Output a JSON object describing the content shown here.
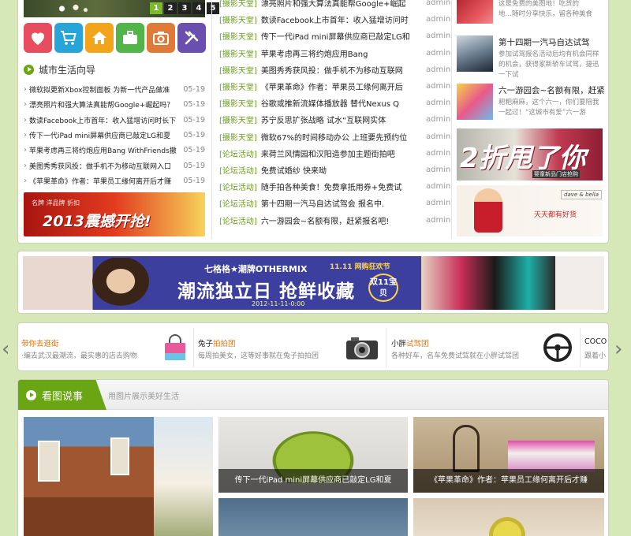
{
  "slider": {
    "pages": [
      "1",
      "2",
      "3",
      "4",
      "5"
    ],
    "active": "1"
  },
  "icon_buttons": [
    {
      "name": "heart-icon",
      "color": "#e84c5f"
    },
    {
      "name": "cart-icon",
      "color": "#27a5d8"
    },
    {
      "name": "home-icon",
      "color": "#f2a51a"
    },
    {
      "name": "briefcase-icon",
      "color": "#52b548"
    },
    {
      "name": "camera-icon",
      "color": "#e07a38"
    },
    {
      "name": "tools-icon",
      "color": "#6a4fb0"
    }
  ],
  "guide": {
    "title": "城市生活向导",
    "items": [
      {
        "text": "微软拟更新Xbox控制面板 为新一代产品做准",
        "date": "05-19"
      },
      {
        "text": "漂亮照片和强大算法真能帮Google+崛起吗？",
        "date": "05-19"
      },
      {
        "text": "数读Facebook上市首年：收入猛增访问时长下",
        "date": "05-19"
      },
      {
        "text": "传下一代iPad mini屏幕供应商已敲定LG和夏",
        "date": "05-19"
      },
      {
        "text": "苹果考虑再三将约炮应用Bang WithFriends撤",
        "date": "05-19"
      },
      {
        "text": "美图秀秀获风投：做手机不为移动互联网入口",
        "date": "05-19"
      },
      {
        "text": "《苹果革命》作者：苹果员工缘何离开后才赚",
        "date": "05-19"
      }
    ]
  },
  "ad_2013": {
    "text_small": "名牌  洋品牌  折扣",
    "text_big": "2013震撼开抢!"
  },
  "mid_list": [
    {
      "cat": "[摄影天堂]",
      "text": "漂亮照片和强大算法真能帮Google+崛起",
      "author": "admin"
    },
    {
      "cat": "[摄影天堂]",
      "text": "数读Facebook上市首年：收入猛增访问时",
      "author": "admin"
    },
    {
      "cat": "[摄影天堂]",
      "text": "传下一代iPad mini屏幕供应商已敲定LG和",
      "author": "admin"
    },
    {
      "cat": "[摄影天堂]",
      "text": "苹果考虑再三将约炮应用Bang",
      "author": "admin"
    },
    {
      "cat": "[摄影天堂]",
      "text": "美图秀秀获风投：做手机不为移动互联网",
      "author": "admin"
    },
    {
      "cat": "[摄影天堂]",
      "text": "《苹果革命》作者：苹果员工缘何离开后",
      "author": "admin"
    },
    {
      "cat": "[摄影天堂]",
      "text": "谷歌或推新流媒体播放器 替代Nexus Q",
      "author": "admin"
    },
    {
      "cat": "[摄影天堂]",
      "text": "苏宁反思扩张战略 试水“互联网实体",
      "author": "admin"
    },
    {
      "cat": "[摄影天堂]",
      "text": "微软67%的时间移动办公 上班要先预约位",
      "author": "admin"
    },
    {
      "cat": "[论坛活动]",
      "text": "来荷兰风情园和汉阳造参加主题街拍吧",
      "author": "admin"
    },
    {
      "cat": "[论坛活动]",
      "text": "免费试婚纱 快来呦",
      "author": "admin"
    },
    {
      "cat": "[论坛活动]",
      "text": "随手拍各种美食！免费拿抵用券+免费试",
      "author": "admin"
    },
    {
      "cat": "[论坛活动]",
      "text": "第十四期一汽马自达试驾会 报名中.",
      "author": "admin"
    },
    {
      "cat": "[论坛活动]",
      "text": "六一游园会~名额有限，赶紧报名吧!",
      "author": "admin"
    }
  ],
  "right": {
    "top_desc": [
      "这是免费的美图地！吃货的",
      "地…随时分享快乐，留各种美食"
    ],
    "items": [
      {
        "title": "第十四期一汽马自达试驾",
        "desc": "参加试驾报名活动后均有机会同样的机会，获得家新轿车试驾，捷迅一下试"
      },
      {
        "title": "六一游园会~名额有限，赶紧",
        "desc": "耙粑麻麻，这个六一，你们要陪我一起过！“这城市有爱”六一游"
      }
    ],
    "ad1_big": "2折甩了你",
    "ad1_small": "婴童新品门店抢购",
    "ad2_logo": "dave & bella",
    "ad2_tag": "天天都有好货"
  },
  "banner": {
    "line1": "七格格★潮牌OTHERMIX",
    "eleven": "11.11 网购狂欢节",
    "line2": "潮流独立日 抢鲜收藏",
    "line3": "2012-11-11-0:00",
    "badge": "双11宝贝"
  },
  "carousel": [
    {
      "title_pre": "",
      "title_hl": "带你去逛街",
      "desc": "·编去武汉最潮流，最实惠的店去购物",
      "icon": "shopping-bag-icon"
    },
    {
      "title_pre": "兔子",
      "title_hl": "拍拍团",
      "desc": "每周拍美女，这等好事就在兔子拍拍团",
      "icon": "camera-icon"
    },
    {
      "title_pre": "小胖",
      "title_hl": "试驾团",
      "desc": "各种好车，名车免费试驾就在小胖试驾团",
      "icon": "steering-wheel-icon"
    },
    {
      "title_pre": "COCO",
      "title_hl": "",
      "desc": "跟着小",
      "icon": ""
    }
  ],
  "photo": {
    "title": "看图说事",
    "subtitle": "用图片展示美好生活",
    "captions": [
      "传下一代iPad mini屏幕供应商已敲定LG和夏",
      "《苹果革命》作者：苹果员工缘何离开后才赚"
    ]
  }
}
